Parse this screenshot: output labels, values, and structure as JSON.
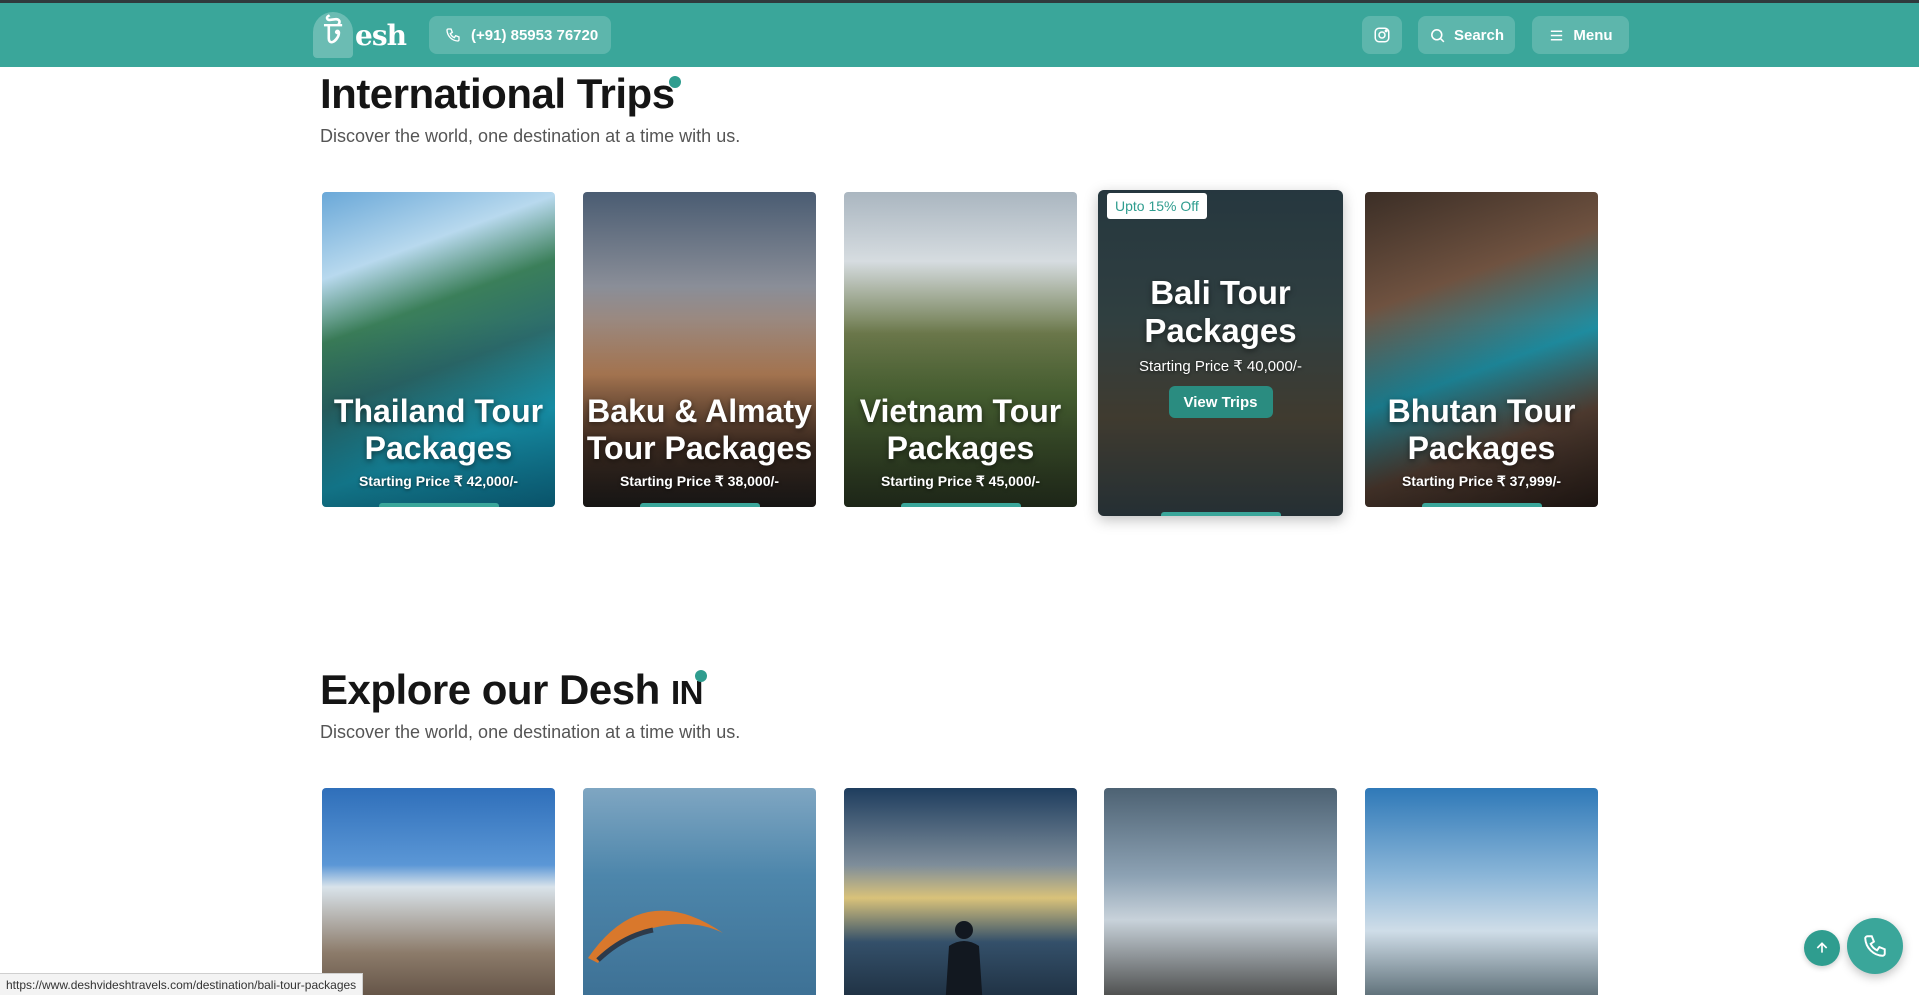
{
  "header": {
    "logo_mark": "ট",
    "logo_text": "esh",
    "phone": "(+91) 85953 76720",
    "search_label": "Search",
    "menu_label": "Menu"
  },
  "international": {
    "title": "International Trips",
    "subtitle": "Discover the world, one destination at a time with us.",
    "cards": [
      {
        "title": "Thailand Tour Packages",
        "price": "Starting Price ₹ 42,000/-"
      },
      {
        "title": "Baku & Almaty Tour Packages",
        "price": "Starting Price ₹ 38,000/-"
      },
      {
        "title": "Vietnam Tour Packages",
        "price": "Starting Price ₹ 45,000/-"
      },
      {
        "title": "Bali Tour Packages",
        "price": "Starting Price ₹ 40,000/-",
        "badge": "Upto 15% Off",
        "button": "View Trips"
      },
      {
        "title": "Bhutan Tour Packages",
        "price": "Starting Price ₹ 37,999/-"
      }
    ]
  },
  "explore": {
    "title": "Explore our Desh",
    "title_suffix": "IN",
    "subtitle": "Discover the world, one destination at a time with us."
  },
  "status_url": "https://www.deshvideshtravels.com/destination/bali-tour-packages",
  "colors": {
    "brand": "#3aa69a",
    "brand_dark": "#2a8c80",
    "accent_dot": "#2f9d8f"
  }
}
